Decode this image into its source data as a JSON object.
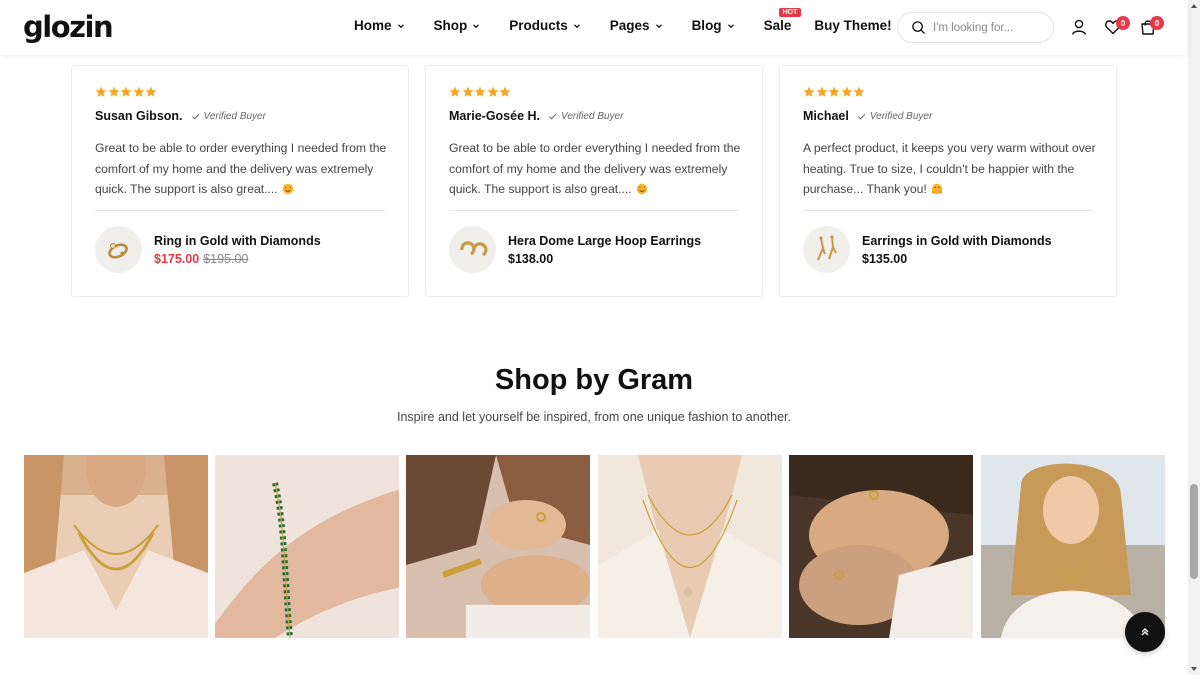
{
  "brand": {
    "logo_text": "glozin",
    "accent": "#e63946",
    "star_color": "#f5a623"
  },
  "nav": {
    "items": [
      {
        "label": "Home",
        "has_dropdown": true
      },
      {
        "label": "Shop",
        "has_dropdown": true
      },
      {
        "label": "Products",
        "has_dropdown": true
      },
      {
        "label": "Pages",
        "has_dropdown": true
      },
      {
        "label": "Blog",
        "has_dropdown": true
      },
      {
        "label": "Sale",
        "has_dropdown": false,
        "badge": "HOT"
      },
      {
        "label": "Buy Theme!",
        "has_dropdown": false
      }
    ]
  },
  "search": {
    "placeholder": "I'm looking for..."
  },
  "header_icons": {
    "wishlist_count": "0",
    "cart_count": "0"
  },
  "reviews": [
    {
      "rating": 5,
      "name": "Susan Gibson.",
      "verified_label": "Verified Buyer",
      "text": "Great to be able to order everything I needed from the comfort of my home and the delivery was extremely quick. The support is also great....",
      "product": {
        "name": "Ring in Gold with Diamonds",
        "price": "$175.00",
        "old_price": "$195.00",
        "on_sale": true,
        "icon": "ring-icon"
      }
    },
    {
      "rating": 5,
      "name": "Marie-Gosée H.",
      "verified_label": "Verified Buyer",
      "text": "Great to be able to order everything I needed from the comfort of my home and the delivery was extremely quick. The support is also great....",
      "product": {
        "name": "Hera Dome Large Hoop Earrings",
        "price": "$138.00",
        "on_sale": false,
        "icon": "hoop-earrings-icon"
      }
    },
    {
      "rating": 5,
      "name": "Michael",
      "verified_label": "Verified Buyer",
      "text": "A perfect product, it keeps you very warm without over heating. True to size, I couldn't be happier with the purchase... Thank you!",
      "product": {
        "name": "Earrings in Gold with Diamonds",
        "price": "$135.00",
        "on_sale": false,
        "icon": "drop-earrings-icon"
      }
    }
  ],
  "gram_section": {
    "title": "Shop by Gram",
    "subtitle": "Inspire and let yourself be inspired, from one unique fashion to another.",
    "tiles": [
      {
        "name": "necklace-layered-photo"
      },
      {
        "name": "bracelet-emerald-photo"
      },
      {
        "name": "rings-hands-photo"
      },
      {
        "name": "pendant-necklace-photo"
      },
      {
        "name": "rings-clasped-photo"
      },
      {
        "name": "smiling-woman-photo"
      }
    ]
  }
}
